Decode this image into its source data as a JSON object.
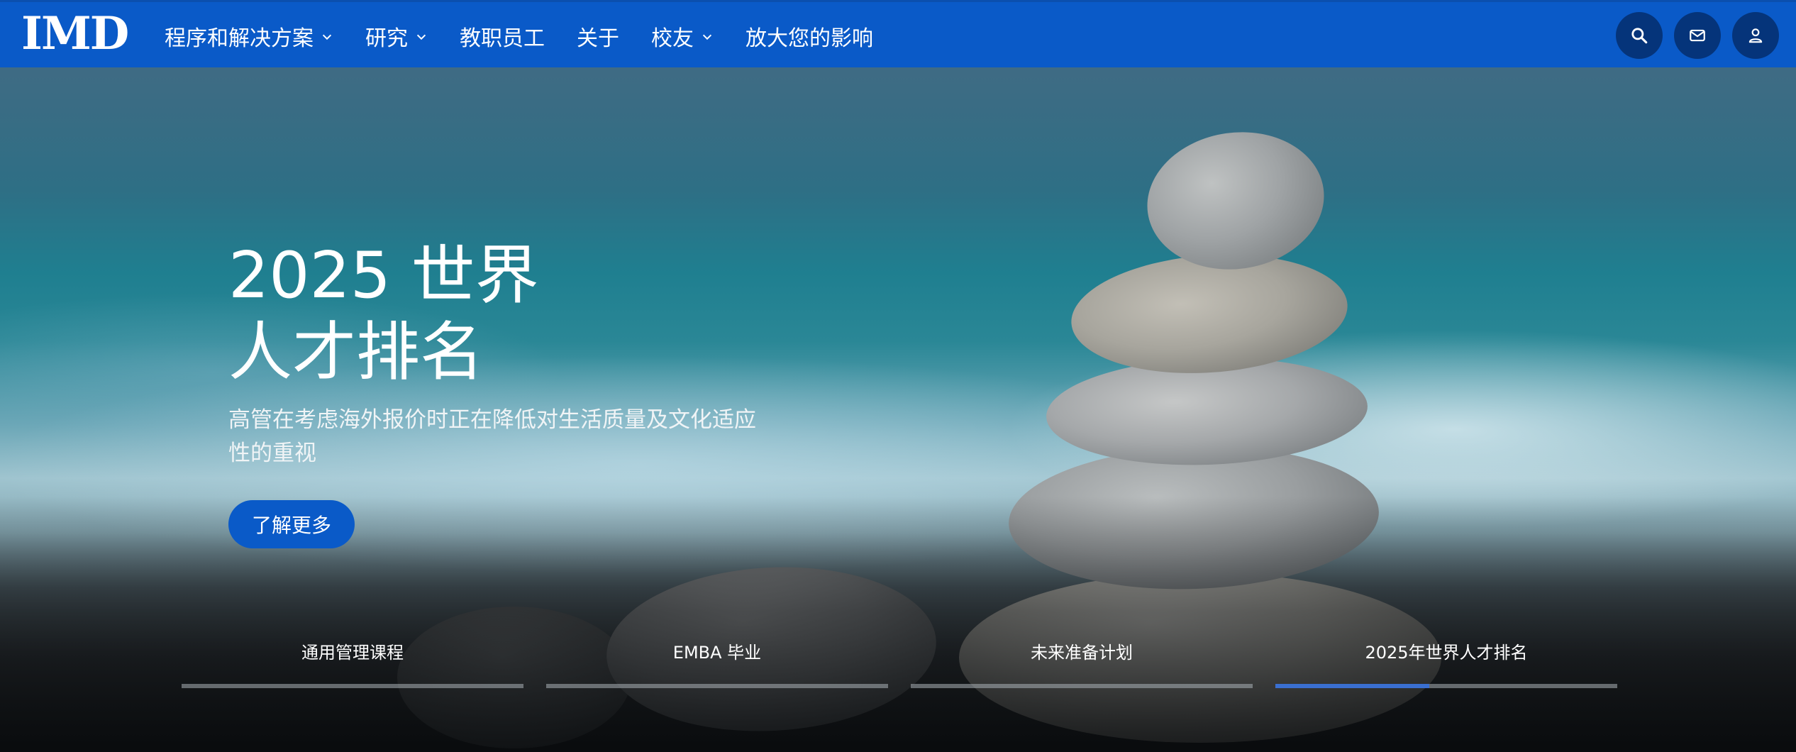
{
  "logo": {
    "text": "IMD"
  },
  "nav": {
    "items": [
      {
        "label": "程序和解决方案",
        "has_dropdown": true
      },
      {
        "label": "研究",
        "has_dropdown": true
      },
      {
        "label": "教职员工",
        "has_dropdown": false
      },
      {
        "label": "关于",
        "has_dropdown": false
      },
      {
        "label": "校友",
        "has_dropdown": true
      },
      {
        "label": "放大您的影响",
        "has_dropdown": false
      }
    ],
    "icons": [
      "search-icon",
      "mail-icon",
      "user-icon"
    ]
  },
  "hero": {
    "title_line1": "2025 世界",
    "title_line2": "人才排名",
    "subtitle": "高管在考虑海外报价时正在降低对生活质量及文化适应性的重视",
    "cta_label": "了解更多"
  },
  "tabs": [
    {
      "label": "通用管理课程",
      "active": false
    },
    {
      "label": "EMBA 毕业",
      "active": false
    },
    {
      "label": "未来准备计划",
      "active": false
    },
    {
      "label": "2025年世界人才排名",
      "active": true
    }
  ],
  "active_tab_progress": 0.45,
  "colors": {
    "brand_blue": "#0a5ac8",
    "icon_button_bg": "#05347a",
    "progress_fill": "#3a6fd0"
  }
}
